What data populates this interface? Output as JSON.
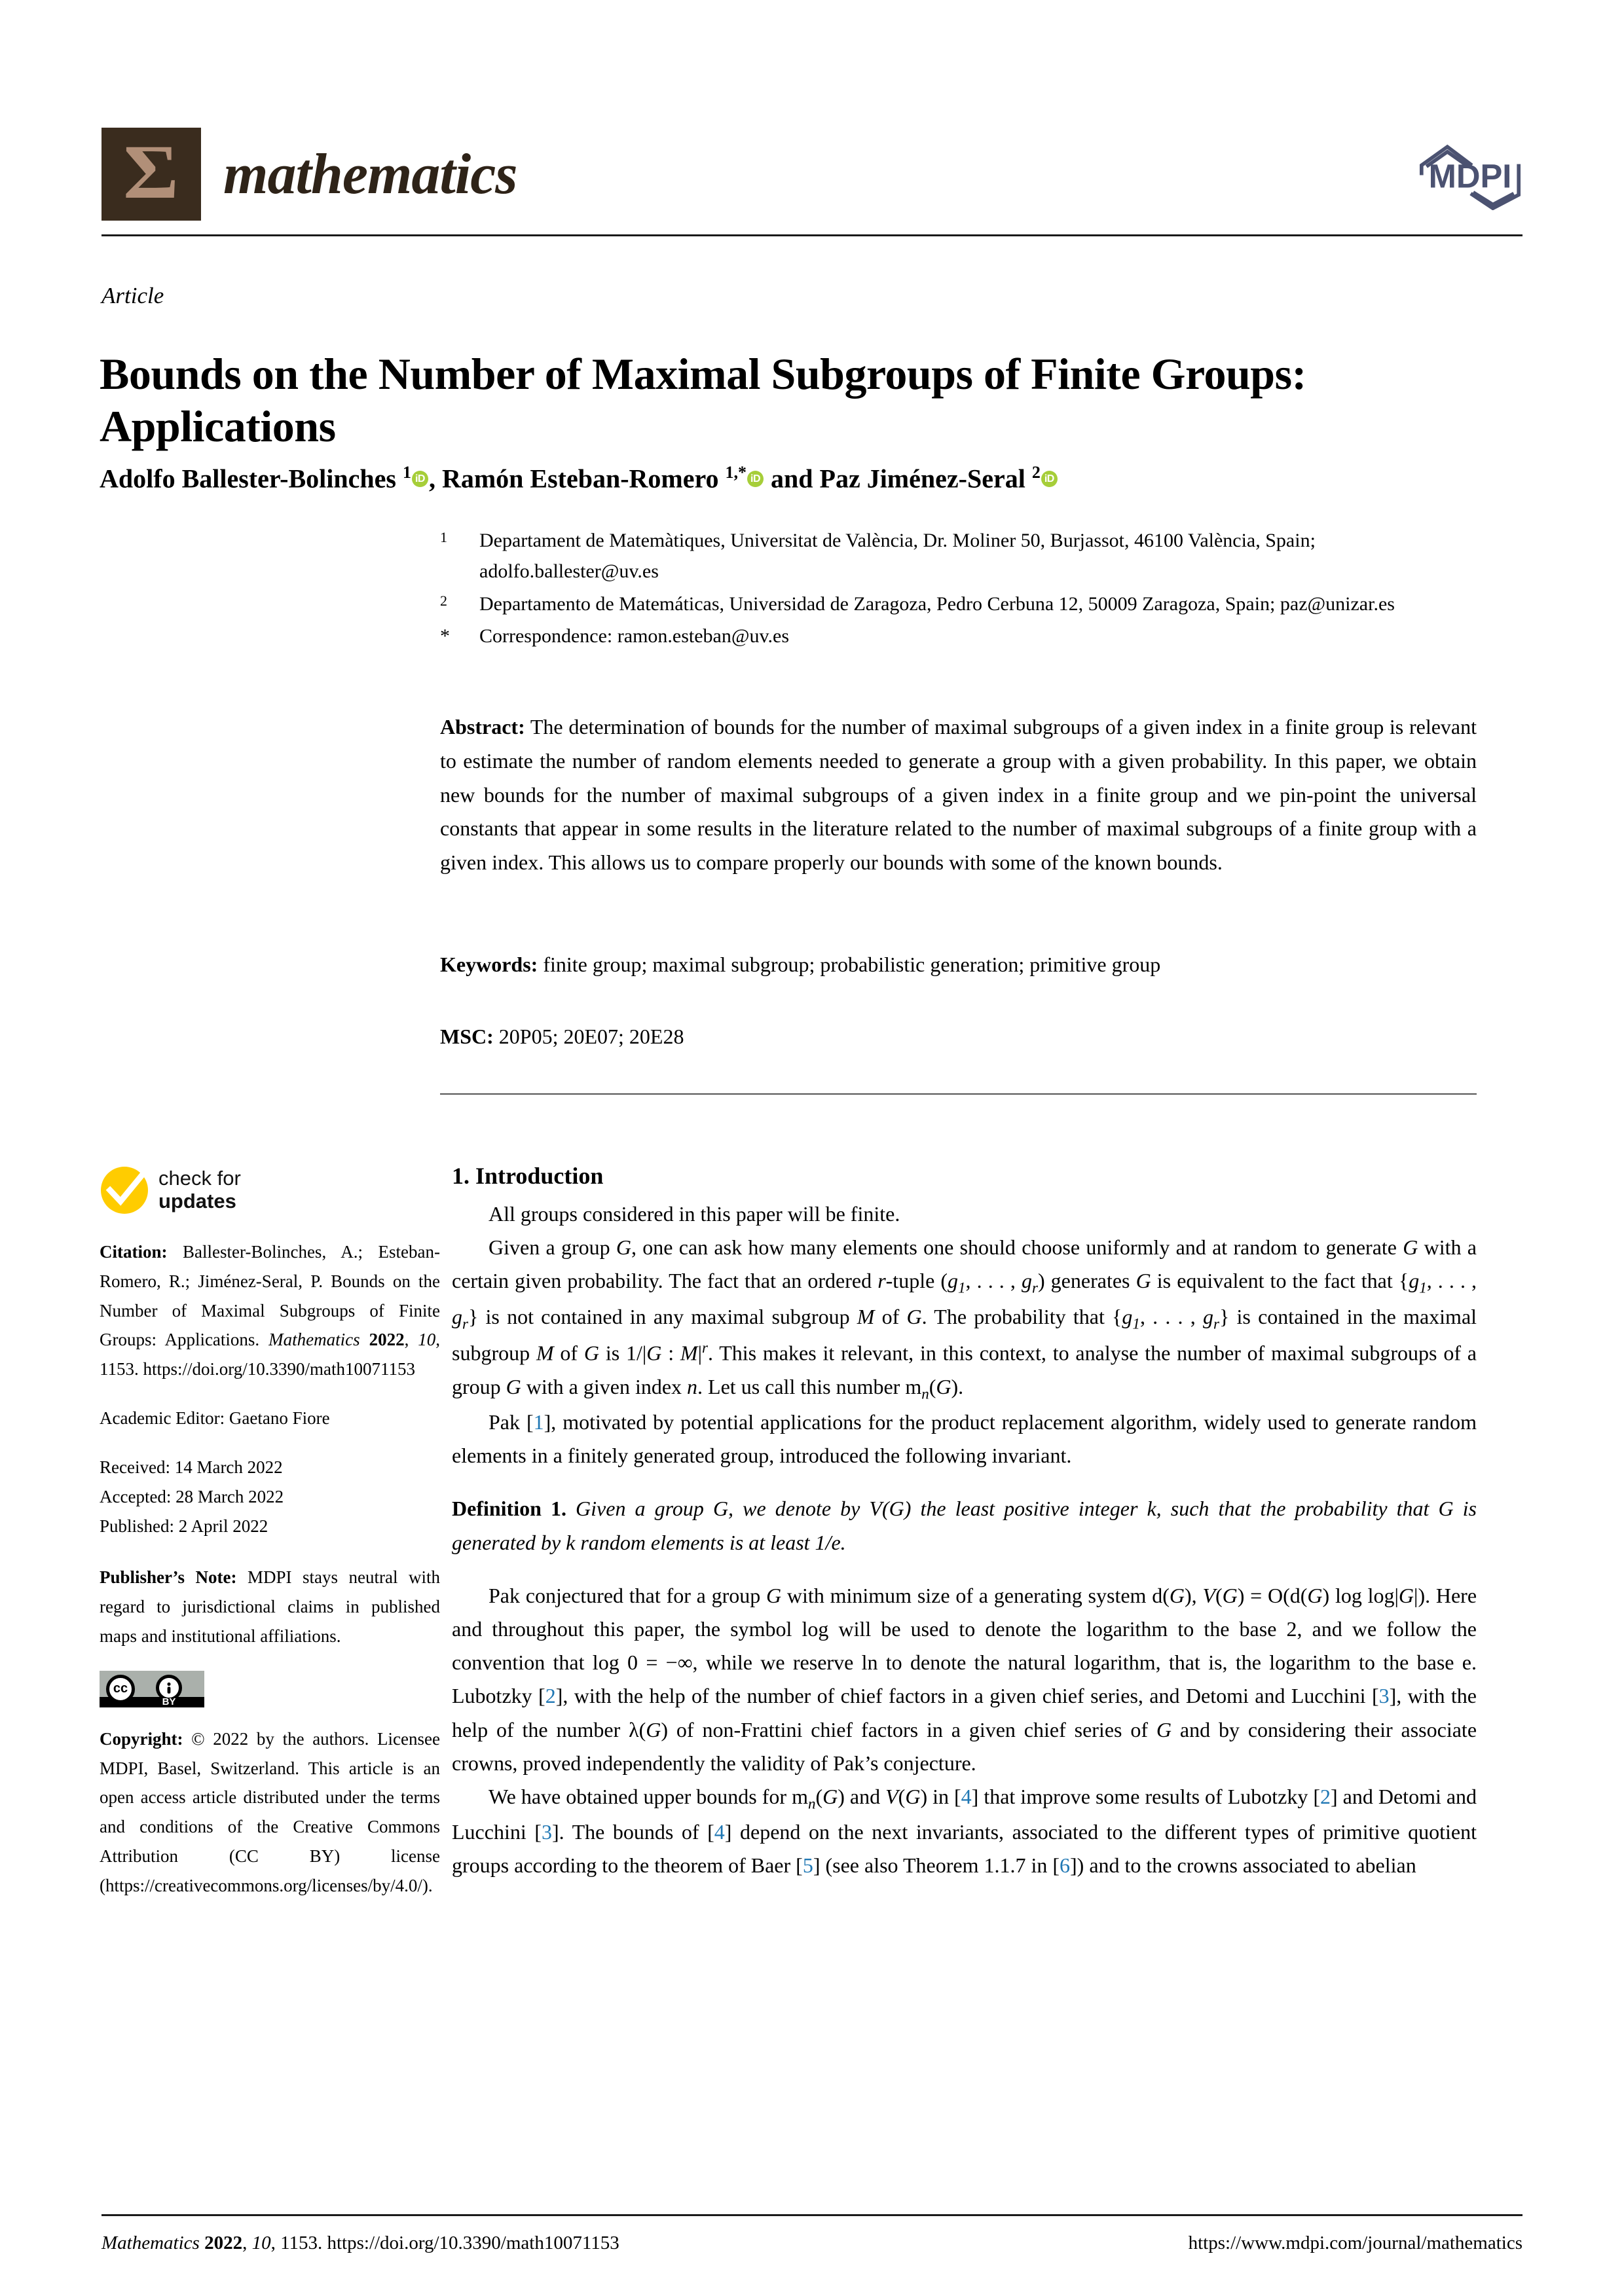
{
  "header": {
    "journal_name": "mathematics",
    "sigma_glyph": "Σ",
    "publisher_logo_text": "MDPI"
  },
  "article": {
    "type_label": "Article",
    "title": "Bounds on the Number of Maximal Subgroups of Finite Groups: Applications",
    "authors_html": "Adolfo Ballester-Bolinches <sup class=\"sup\">1</sup><span class=\"orcid\" data-name=\"orcid-icon\">iD</span>, Ramón Esteban-Romero <sup class=\"sup\">1,*</sup><span class=\"orcid\" data-name=\"orcid-icon\">iD</span> and Paz Jiménez-Seral <sup class=\"sup\">2</sup><span class=\"orcid\" data-name=\"orcid-icon\">iD</span>"
  },
  "affiliations": [
    {
      "marker": "1",
      "text": "Departament de Matemàtiques, Universitat de València, Dr. Moliner 50, Burjassot, 46100 València, Spain; adolfo.ballester@uv.es"
    },
    {
      "marker": "2",
      "text": "Departamento de Matemáticas, Universidad de Zaragoza, Pedro Cerbuna 12, 50009 Zaragoza, Spain; paz@unizar.es"
    },
    {
      "marker": "*",
      "text": "Correspondence: ramon.esteban@uv.es"
    }
  ],
  "abstract": {
    "label": "Abstract:",
    "text": "The determination of bounds for the number of maximal subgroups of a given index in a finite group is relevant to estimate the number of random elements needed to generate a group with a given probability. In this paper, we obtain new bounds for the number of maximal subgroups of a given index in a finite group and we pin-point the universal constants that appear in some results in the literature related to the number of maximal subgroups of a finite group with a given index. This allows us to compare properly our bounds with some of the known bounds."
  },
  "keywords": {
    "label": "Keywords:",
    "text": "finite group; maximal subgroup; probabilistic generation; primitive group"
  },
  "msc": {
    "label": "MSC:",
    "text": "20P05; 20E07; 20E28"
  },
  "sidebar": {
    "check_for_updates": {
      "line1": "check for",
      "line2": "updates"
    },
    "citation_label": "Citation:",
    "citation_html": "<b>Citation:</b> Ballester-Bolinches, A.; Esteban-Romero, R.; Jiménez-Seral, P. Bounds on the Number of Maximal Subgroups of Finite Groups: Applications. <i>Mathematics</i> <b>2022</b>, <i>10</i>, 1153. https://doi.org/10.3390/math10071153",
    "academic_editor": "Academic Editor: Gaetano Fiore",
    "dates": {
      "received": "Received: 14 March 2022",
      "accepted": "Accepted: 28 March 2022",
      "published": "Published: 2 April 2022"
    },
    "publishers_note_html": "<b>Publisher’s Note:</b> MDPI stays neutral with regard to jurisdictional claims in published maps and institutional affiliations.",
    "license_badge": {
      "cc_text": "cc",
      "person_glyph": "ⓘ",
      "by_text": "BY"
    },
    "copyright_html": "<b>Copyright:</b> © 2022 by the authors. Licensee MDPI, Basel, Switzerland. This article is an open access article distributed under the terms and conditions of the Creative Commons Attribution (CC BY) license (https://creativecommons.org/licenses/by/4.0/)."
  },
  "body": {
    "section_heading": "1. Introduction",
    "p1_html": "All groups considered in this paper will be finite.",
    "p2_html": "Given a group <i>G</i>, one can ask how many elements one should choose uniformly and at random to generate <i>G</i> with a certain given probability. The fact that an ordered <i>r</i>-tuple (<i>g</i><sub class=\"sub\">1</sub>, . . . , <i>g<sub class=\"sub\">r</sub></i>) generates <i>G</i> is equivalent to the fact that {<i>g</i><sub class=\"sub\">1</sub>, . . . , <i>g<sub class=\"sub\">r</sub></i>} is not contained in any maximal subgroup <i>M</i> of <i>G</i>. The probability that {<i>g</i><sub class=\"sub\">1</sub>, . . . , <i>g<sub class=\"sub\">r</sub></i>} is contained in the maximal subgroup <i>M</i> of <i>G</i> is 1/|<i>G</i> : <i>M</i>|<sup class=\"supr\">r</sup>. This makes it relevant, in this context, to analyse the number of maximal subgroups of a group <i>G</i> with a given index <i>n</i>. Let us call this number m<sub class=\"sub\">n</sub>(<i>G</i>).",
    "p3_html": "Pak [<span class=\"cite\">1</span>], motivated by potential applications for the product replacement algorithm, widely used to generate random elements in a finitely generated group, introduced the following invariant.",
    "definition_name": "Definition 1.",
    "definition_html": "Given a group G, we denote by <span class=\"cal\">V</span>(G) the least positive integer k, such that the probability that G is generated by k random elements is at least 1/e.",
    "p4_html": "Pak conjectured that for a group <i>G</i> with minimum size of a generating system d(<i>G</i>), <span class=\"cal\">V</span>(<i>G</i>) = O(d(<i>G</i>) log log|<i>G</i>|). Here and throughout this paper, the symbol log will be used to denote the logarithm to the base 2, and we follow the convention that log 0 = −∞, while we reserve ln to denote the natural logarithm, that is, the logarithm to the base e. Lubotzky [<span class=\"cite\">2</span>], with the help of the number of chief factors in a given chief series, and Detomi and Lucchini [<span class=\"cite\">3</span>], with the help of the number λ(<i>G</i>) of non-Frattini chief factors in a given chief series of <i>G</i> and by considering their associate crowns, proved independently the validity of Pak’s conjecture.",
    "p5_html": "We have obtained upper bounds for m<sub class=\"sub\">n</sub>(<i>G</i>) and <span class=\"cal\">V</span>(<i>G</i>) in [<span class=\"cite\">4</span>] that improve some results of Lubotzky [<span class=\"cite\">2</span>] and Detomi and Lucchini [<span class=\"cite\">3</span>]. The bounds of [<span class=\"cite\">4</span>] depend on the next invariants, associated to the different types of primitive quotient groups according to the theorem of Baer [<span class=\"cite\">5</span>] (see also Theorem 1.1.7 in [<span class=\"cite\">6</span>]) and to the crowns associated to abelian"
  },
  "footer": {
    "left_html": "<i>Mathematics</i> <b>2022</b>, <i>10</i>, 1153. https://doi.org/10.3390/math10071153",
    "right": "https://www.mdpi.com/journal/mathematics"
  },
  "colors": {
    "logo_brown": "#3a2c1e",
    "logo_sigma": "#b18f78",
    "mdpi_blue": "#4b5271",
    "orcid_green": "#a6ce39",
    "citation_blue": "#1f77b4",
    "check_yellow": "#ffcc00"
  }
}
